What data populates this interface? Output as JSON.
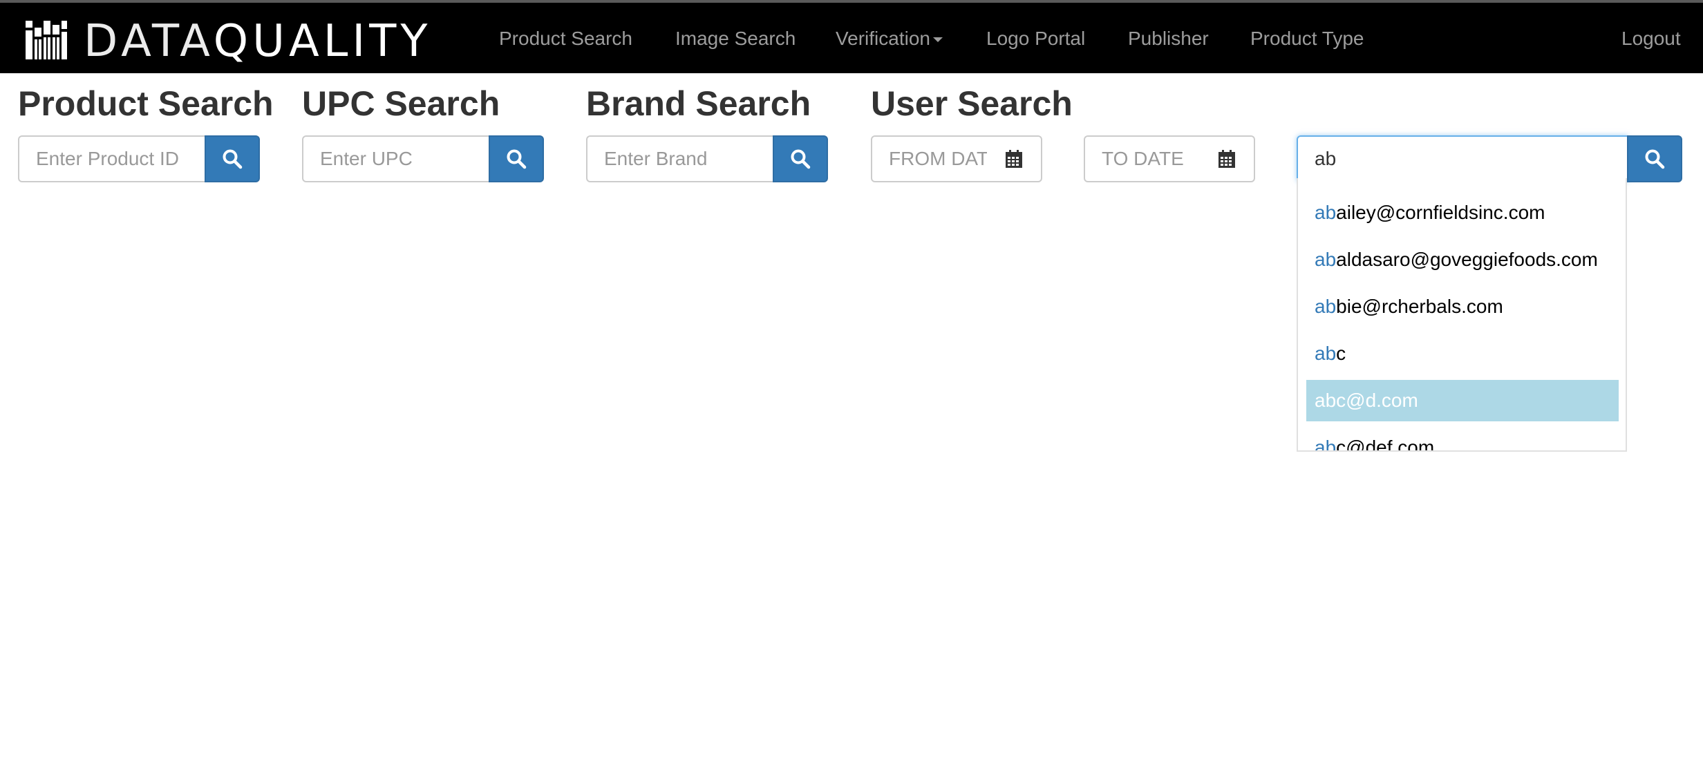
{
  "brand": {
    "name_light": "DATA",
    "name_bold": "QUALITY"
  },
  "nav": {
    "items": [
      "Product Search",
      "Image Search",
      "Verification",
      "Logo Portal",
      "Publisher",
      "Product Type"
    ],
    "logout": "Logout"
  },
  "sections": {
    "product": {
      "title": "Product Search",
      "placeholder": "Enter Product ID"
    },
    "upc": {
      "title": "UPC Search",
      "placeholder": "Enter UPC"
    },
    "brand": {
      "title": "Brand Search",
      "placeholder": "Enter Brand"
    },
    "user": {
      "title": "User Search",
      "from_placeholder": "FROM DATE",
      "to_placeholder": "TO DATE",
      "query": "ab"
    }
  },
  "autocomplete": {
    "match": "ab",
    "items": [
      {
        "prefix": "ab",
        "rest": "ailey@cornfieldsinc.com"
      },
      {
        "prefix": "ab",
        "rest": "aldasaro@goveggiefoods.com"
      },
      {
        "prefix": "ab",
        "rest": "bie@rcherbals.com"
      },
      {
        "prefix": "ab",
        "rest": "c"
      },
      {
        "prefix": "ab",
        "rest": "c@d.com"
      },
      {
        "prefix": "ab",
        "rest": "c@def.com"
      }
    ],
    "active_index": 4
  },
  "colors": {
    "navbar": "#000000",
    "primary": "#337ab7",
    "active_item": "#add8e6"
  },
  "icons": {
    "search": "search-icon",
    "calendar": "calendar-icon",
    "logo": "barcode-logo-icon"
  }
}
